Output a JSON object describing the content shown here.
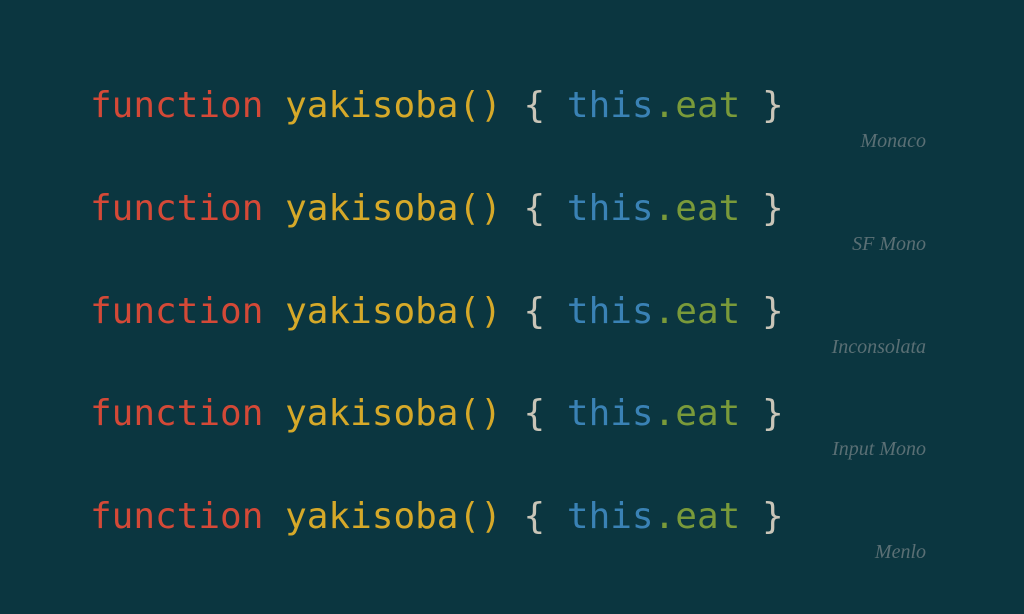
{
  "code": {
    "keyword": "function",
    "sp1": " ",
    "funcname": "yakisoba",
    "parens": "()",
    "sp2": " ",
    "brace_open": "{",
    "sp3": " ",
    "this_kw": "this",
    "dot": ".",
    "method": "eat",
    "sp4": " ",
    "brace_close": "}"
  },
  "samples": [
    {
      "font_label": "Monaco"
    },
    {
      "font_label": "SF Mono"
    },
    {
      "font_label": "Inconsolata"
    },
    {
      "font_label": "Input Mono"
    },
    {
      "font_label": "Menlo"
    }
  ]
}
